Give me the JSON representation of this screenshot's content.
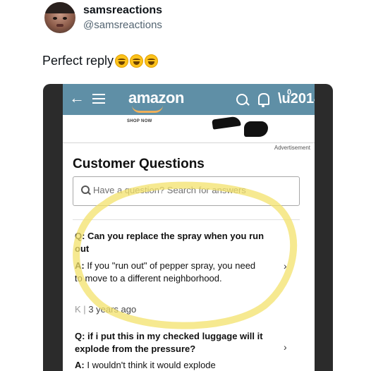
{
  "tweet": {
    "display_name": "samsreactions",
    "handle": "@samsreactions",
    "text": "Perfect reply",
    "emojis": [
      "face-with-tears-of-joy",
      "face-with-tears-of-joy",
      "face-with-tears-of-joy"
    ]
  },
  "amazon": {
    "topbar": {
      "back_icon": "←",
      "logo": "amazon",
      "cart_count": "0",
      "color": "#5f8fa6"
    },
    "ad": {
      "shop_now": "SHOP NOW",
      "label": "Advertisement"
    },
    "customer_questions": {
      "title": "Customer Questions",
      "search_placeholder": "Have a question? Search for answers",
      "items": [
        {
          "question": "Q: Can you replace the spray when you run out",
          "answer_prefix": "A:",
          "answer": "If you \"run out\" of pepper spray, you need to move to a different neighborhood.",
          "author_initial": "K",
          "age": "3 years ago"
        },
        {
          "question": "Q: if i put this in my checked luggage will it explode from the pressure?",
          "answer_prefix": "A:",
          "answer": "I wouldn't think it would explode"
        }
      ]
    },
    "highlight_color": "#f3e26b"
  }
}
